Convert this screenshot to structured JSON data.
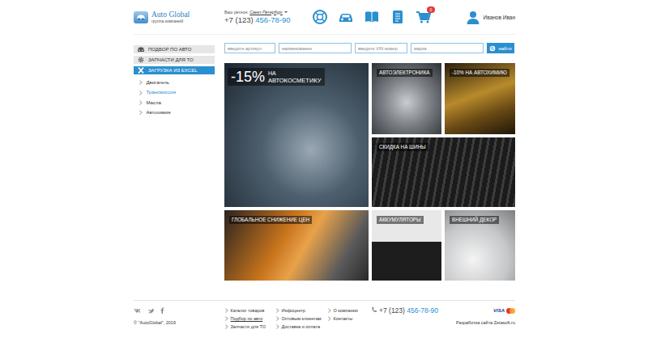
{
  "logo": {
    "title": "Auto Global",
    "subtitle": "группа компаний"
  },
  "region": {
    "label": "Ваш регион:",
    "value": "Санкт-Петербург"
  },
  "phone": {
    "code": "+7 (123)",
    "number": "456-78-90"
  },
  "cart": {
    "badge": "0"
  },
  "user": {
    "name": "Иванов Иван"
  },
  "sidebar": {
    "items": [
      {
        "label": "ПОДБОР ПО АВТО",
        "selected": false
      },
      {
        "label": "ЗАПЧАСТИ ДЛЯ ТО",
        "selected": false
      },
      {
        "label": "ЗАГРУЗКА ИЗ EXCEL",
        "selected": true
      }
    ],
    "subitems": [
      {
        "label": "Двигатель",
        "selected": false
      },
      {
        "label": "Трансмиссия",
        "selected": true
      },
      {
        "label": "Масла",
        "selected": false
      },
      {
        "label": "Автохимия",
        "selected": false
      }
    ]
  },
  "search": {
    "fields": [
      {
        "placeholder": "введите артикул"
      },
      {
        "placeholder": "наименование"
      },
      {
        "placeholder": "введите VIN номер"
      },
      {
        "placeholder": "марка"
      }
    ],
    "button": "найти"
  },
  "tiles": [
    {
      "kind": "promo",
      "discount": "-15%",
      "prefix": "НА",
      "label": "АВТОКОСМЕТИКУ"
    },
    {
      "kind": "label",
      "label": "АВТОЭЛЕКТРОНИКА"
    },
    {
      "kind": "label",
      "label": "-10% НА АВТОХИМИЮ"
    },
    {
      "kind": "label",
      "label": "СКИДКА НА ШИНЫ"
    },
    {
      "kind": "label",
      "label": "ГЛОБАЛЬНОЕ СНИЖЕНИЕ ЦЕН"
    },
    {
      "kind": "label",
      "label": "АККУМУЛЯТОРЫ"
    },
    {
      "kind": "label",
      "label": "ВНЕШНИЙ ДЕКОР"
    }
  ],
  "footer": {
    "copyright": "© \"AutoGlobal\", 2016",
    "columns": [
      [
        {
          "label": "Каталог товаров",
          "selected": false
        },
        {
          "label": "Подбор по авто",
          "selected": true
        },
        {
          "label": "Запчасти для ТО",
          "selected": false
        }
      ],
      [
        {
          "label": "Инфоцентр",
          "selected": false
        },
        {
          "label": "Оптовым клиентам",
          "selected": false
        },
        {
          "label": "Доставка и оплата",
          "selected": false
        }
      ],
      [
        {
          "label": "О компании",
          "selected": false
        },
        {
          "label": "Контакты",
          "selected": false
        }
      ]
    ],
    "phone": {
      "code": "+7 (123)",
      "number": "456-78-90"
    },
    "payment": "VISA",
    "developer": "Разработка сайта Zetasoft.ru"
  }
}
